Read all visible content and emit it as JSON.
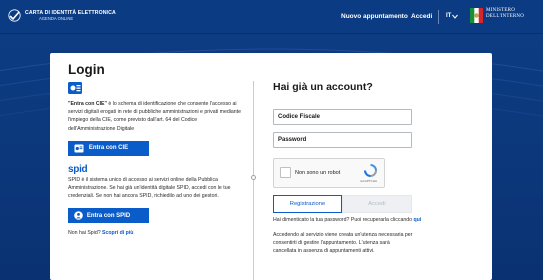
{
  "header": {
    "brand_title": "CARTA DI IDENTITÀ ELETTRONICA",
    "brand_subtitle": "AGENDA ONLINE",
    "nav_new": "Nuovo appuntamento",
    "nav_login": "Accedi",
    "lang": "IT",
    "ministry_line1": "MINISTERO",
    "ministry_line2": "DELL'INTERNO"
  },
  "login": {
    "title": "Login",
    "cie_bold": "\"Entra con CIE\"",
    "cie_text": " è lo schema di identificazione che consente l'accesso ai servizi digitali erogati in rete di pubbliche amministrazioni e privati mediante l'impiego della CIE, come previsto dall'art. 64 del Codice dell'Amministrazione Digitale",
    "cie_button": "Entra con CIE",
    "spid_logo": "spid",
    "spid_text": "SPID è il sistema unico di accesso ai servizi online della Pubblica Amministrazione. Se hai già un'identità digitale SPID, accedi con le tue credenziali. Se non hai ancora SPID, richiedilo ad uno dei gestori.",
    "spid_button": "Entra con SPID",
    "no_spid": "Non hai Spid?",
    "learn_more": "Scopri di più"
  },
  "account": {
    "title": "Hai già un account?",
    "fiscal_code_placeholder": "Codice Fiscale",
    "password_placeholder": "Password",
    "recaptcha_label": "Non sono un robot",
    "recaptcha_brand": "reCAPTCHA",
    "register_tab": "Registrazione",
    "access_tab": "Accedi",
    "forgot_text": "Hai dimenticato la tua password? Puoi recuperarla cliccando",
    "forgot_link": "qui",
    "info_text": "Accedendo al servizio viene creata un'utenza necessaria per consentirti di gestire l'appuntamento. L'utenza sarà cancellata in assenza di appuntamenti attivi."
  },
  "colors": {
    "primary_blue": "#0a5cc8",
    "header_blue": "#0b3b82"
  }
}
